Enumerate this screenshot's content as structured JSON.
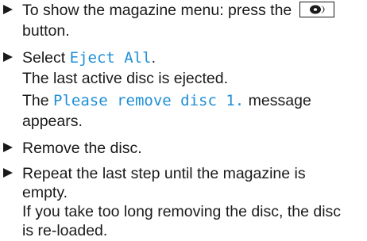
{
  "steps": [
    {
      "line1_prefix": "To show the magazine menu: press the",
      "button_icon": "disc-button-icon",
      "line2": "button."
    },
    {
      "select_prefix": "Select ",
      "select_value": "Eject All",
      "select_suffix": ".",
      "result_line": "The last active disc is ejected.",
      "msg_prefix": "The ",
      "msg_value": "Please remove disc 1.",
      "msg_suffix": " message",
      "msg_line2": "appears."
    },
    {
      "text": "Remove the disc."
    },
    {
      "line1": "Repeat the last step until the magazine is",
      "line2": "empty.",
      "line3": "If you take too long removing the disc, the disc",
      "line4": "is re-loaded."
    }
  ],
  "colors": {
    "text": "#1a1a1a",
    "highlight": "#1d8fd6"
  }
}
